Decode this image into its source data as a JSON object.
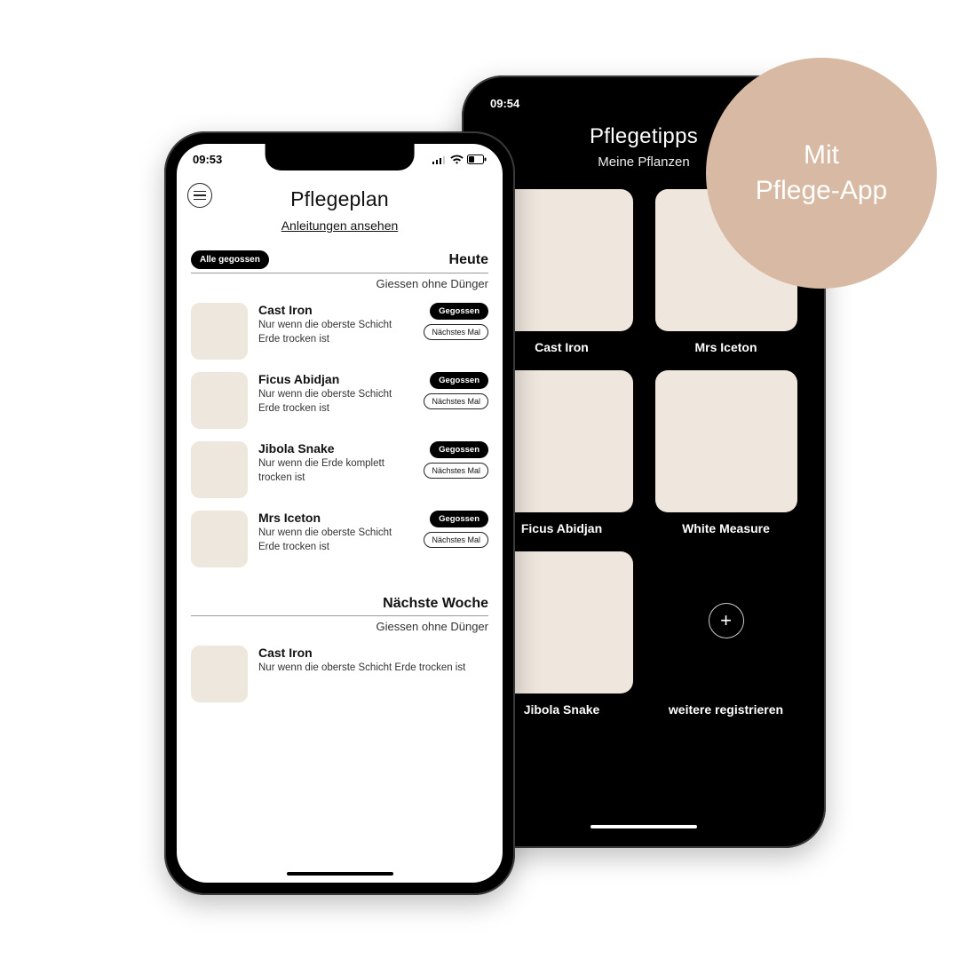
{
  "badge": {
    "line1": "Mit",
    "line2": "Pflege-App"
  },
  "phoneA": {
    "time": "09:53",
    "title": "Pflegeplan",
    "link": "Anleitungen ansehen",
    "chip": "Alle gegossen",
    "today": {
      "title": "Heute",
      "sub": "Giessen ohne Dünger",
      "items": [
        {
          "name": "Cast Iron",
          "desc": "Nur wenn die oberste Schicht Erde trocken ist",
          "thumb": "castiron"
        },
        {
          "name": "Ficus Abidjan",
          "desc": "Nur wenn die oberste Schicht Erde trocken ist",
          "thumb": "ficus"
        },
        {
          "name": "Jibola Snake",
          "desc": "Nur wenn die Erde komplett trocken ist",
          "thumb": "snake"
        },
        {
          "name": "Mrs Iceton",
          "desc": "Nur wenn die oberste Schicht Erde trocken ist",
          "thumb": "iceton"
        }
      ]
    },
    "next": {
      "title": "Nächste Woche",
      "sub": "Giessen ohne Dünger",
      "items": [
        {
          "name": "Cast Iron",
          "desc": "Nur wenn die oberste Schicht Erde trocken ist",
          "thumb": "castiron"
        }
      ]
    },
    "btn_done": "Gegossen",
    "btn_skip": "Nächstes Mal"
  },
  "phoneB": {
    "time": "09:54",
    "title": "Pflegetipps",
    "sub": "Meine Pflanzen",
    "tiles": [
      {
        "label": "Cast Iron",
        "thumb": "castiron"
      },
      {
        "label": "Mrs Iceton",
        "thumb": "iceton"
      },
      {
        "label": "Ficus Abidjan",
        "thumb": "ficus"
      },
      {
        "label": "White Measure",
        "thumb": "white"
      },
      {
        "label": "Jibola Snake",
        "thumb": "snake"
      }
    ],
    "add_label": "weitere registrieren"
  }
}
